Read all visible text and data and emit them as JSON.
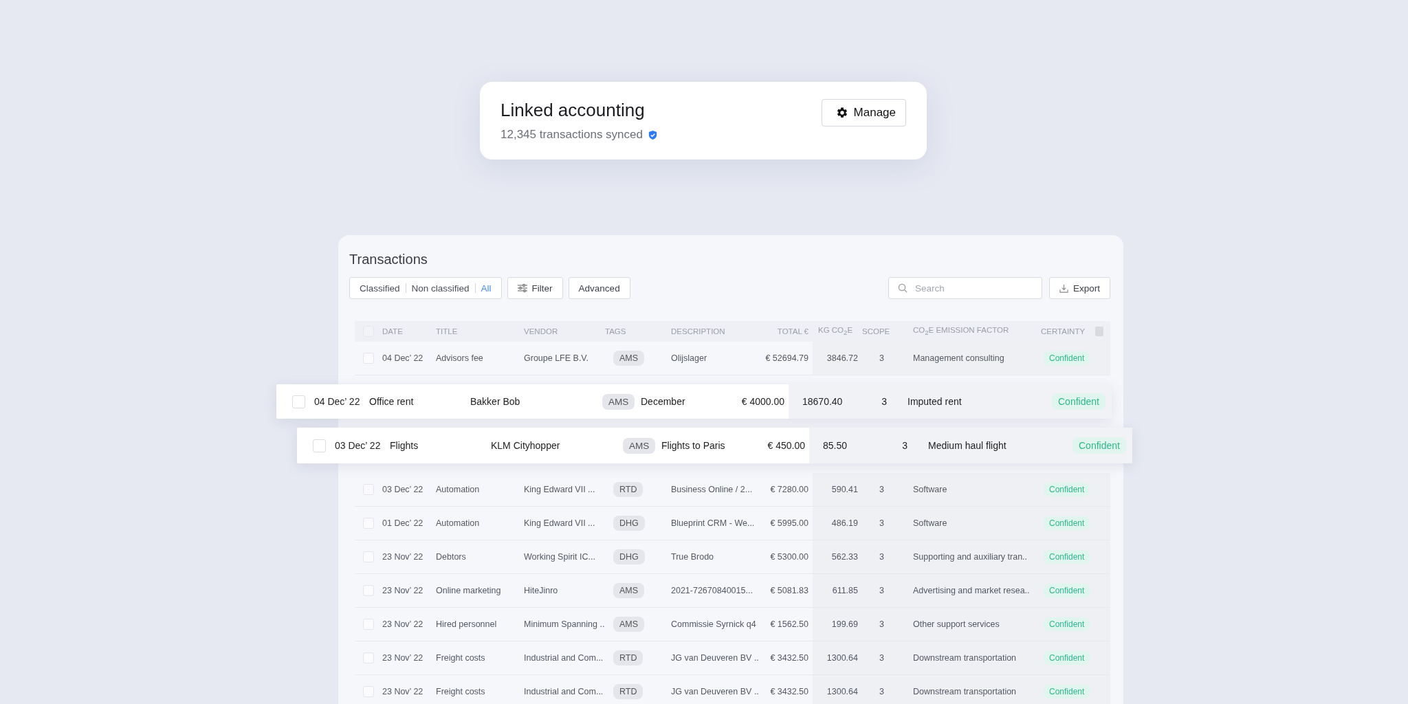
{
  "linked_card": {
    "title": "Linked accounting",
    "subtitle": "12,345 transactions synced",
    "verified": true,
    "button": "Manage"
  },
  "transactions": {
    "title": "Transactions",
    "segments": [
      {
        "label": "Classified",
        "selected": false
      },
      {
        "label": "Non classified",
        "selected": false
      },
      {
        "label": "All",
        "selected": true
      }
    ],
    "filter_button": "Filter",
    "advanced_button": "Advanced",
    "search": {
      "placeholder": "Search"
    },
    "export_button": "Export",
    "table": {
      "select_all": {
        "checked": false
      },
      "columns": [
        "DATE",
        "TITLE",
        "VENDOR",
        "TAGS",
        "DESCRIPTION",
        "TOTAL €",
        "KG CO$_{2}$E",
        "SCOPE",
        "CO$_{2}$E EMISSION FACTOR",
        "CERTAINTY"
      ],
      "rows": [
        {
          "highlighted": false,
          "checked": false,
          "date": "04 Dec’ 22",
          "title": "Advisors fee",
          "vendor": "Groupe LFE B.V.",
          "tag": "AMS",
          "description": "Olijslager",
          "total": "€ 52694.79",
          "kg_co2e": "3846.72",
          "scope": "3",
          "factor": "Management consulting",
          "certainty": "Confident"
        },
        {
          "highlighted": true,
          "checked": false,
          "date": "04 Dec’ 22",
          "title": "Office rent",
          "vendor": "Bakker Bob",
          "tag": "AMS",
          "description": "December",
          "total": "€ 4000.00",
          "kg_co2e": "18670.40",
          "scope": "3",
          "factor": "Imputed rent",
          "certainty": "Confident"
        },
        {
          "highlighted": true,
          "checked": false,
          "date": "03 Dec’ 22",
          "title": "Flights",
          "vendor": "KLM Cityhopper",
          "tag": "AMS",
          "description": "Flights to Paris",
          "total": "€ 450.00",
          "kg_co2e": "85.50",
          "scope": "3",
          "factor": "Medium haul flight",
          "certainty": "Confident"
        },
        {
          "highlighted": false,
          "checked": false,
          "date": "03 Dec’ 22",
          "title": "Automation",
          "vendor": "King Edward VII ...",
          "tag": "RTD",
          "description": "Business Online / 2...",
          "total": "€ 7280.00",
          "kg_co2e": "590.41",
          "scope": "3",
          "factor": "Software",
          "certainty": "Confident"
        },
        {
          "highlighted": false,
          "checked": false,
          "date": "01 Dec’ 22",
          "title": "Automation",
          "vendor": "King Edward VII ...",
          "tag": "DHG",
          "description": "Blueprint CRM - We...",
          "total": "€ 5995.00",
          "kg_co2e": "486.19",
          "scope": "3",
          "factor": "Software",
          "certainty": "Confident"
        },
        {
          "highlighted": false,
          "checked": false,
          "date": "23 Nov’ 22",
          "title": "Debtors",
          "vendor": "Working Spirit IC...",
          "tag": "DHG",
          "description": "True Brodo",
          "total": "€ 5300.00",
          "kg_co2e": "562.33",
          "scope": "3",
          "factor": "Supporting and auxiliary tran..",
          "certainty": "Confident"
        },
        {
          "highlighted": false,
          "checked": false,
          "date": "23 Nov’ 22",
          "title": "Online marketing",
          "vendor": "HiteJinro",
          "tag": "AMS",
          "description": "2021-72670840015...",
          "total": "€ 5081.83",
          "kg_co2e": "611.85",
          "scope": "3",
          "factor": "Advertising and market resea..",
          "certainty": "Confident"
        },
        {
          "highlighted": false,
          "checked": false,
          "date": "23 Nov’ 22",
          "title": "Hired personnel",
          "vendor": "Minimum Spanning ..",
          "tag": "AMS",
          "description": "Commissie Syrnick q4",
          "total": "€ 1562.50",
          "kg_co2e": "199.69",
          "scope": "3",
          "factor": "Other support services",
          "certainty": "Confident"
        },
        {
          "highlighted": false,
          "checked": false,
          "date": "23 Nov’ 22",
          "title": "Freight costs",
          "vendor": "Industrial and Com...",
          "tag": "RTD",
          "description": "JG van Deuveren BV ..",
          "total": "€ 3432.50",
          "kg_co2e": "1300.64",
          "scope": "3",
          "factor": "Downstream transportation",
          "certainty": "Confident"
        },
        {
          "highlighted": false,
          "checked": false,
          "date": "23 Nov’ 22",
          "title": "Freight costs",
          "vendor": "Industrial and Com...",
          "tag": "RTD",
          "description": "JG van Deuveren BV ..",
          "total": "€ 3432.50",
          "kg_co2e": "1300.64",
          "scope": "3",
          "factor": "Downstream transportation",
          "certainty": "Confident"
        }
      ]
    }
  }
}
